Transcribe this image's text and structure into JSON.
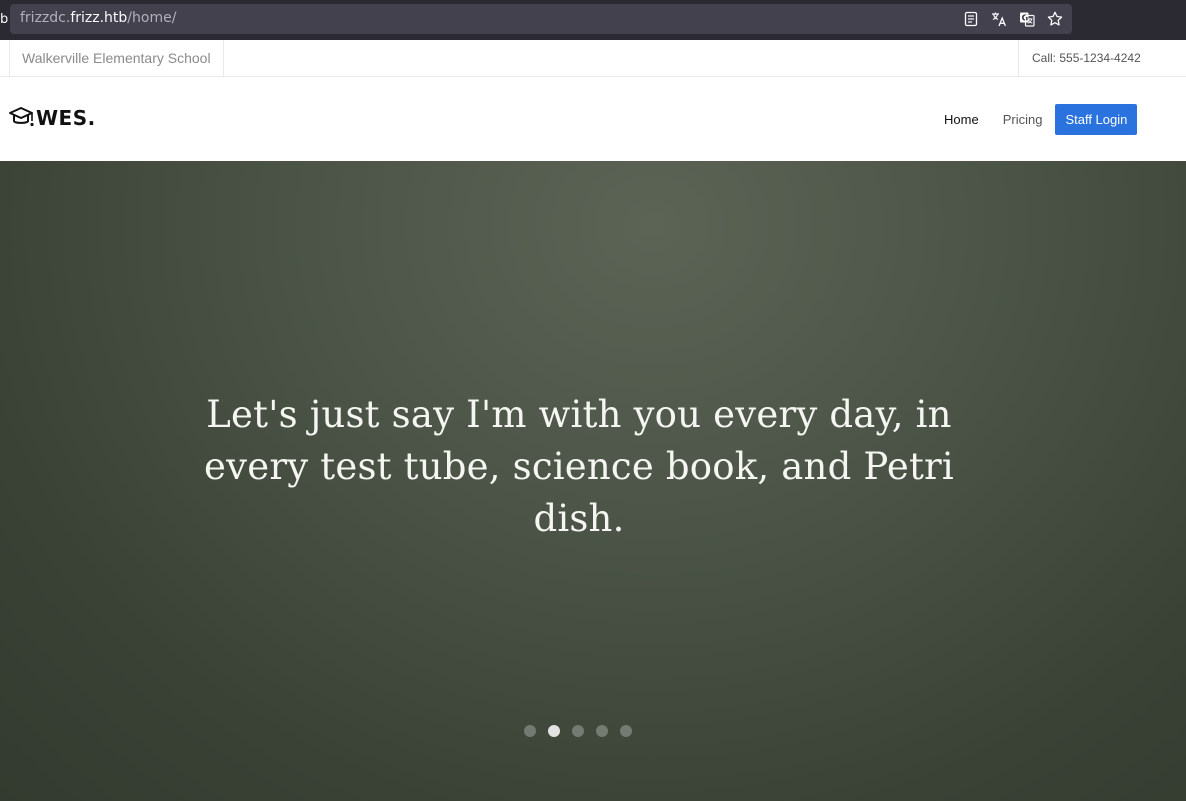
{
  "browser": {
    "tab_edge": "b",
    "url_prefix": "frizzdc.",
    "url_domain": "frizz.htb",
    "url_path": "/home/",
    "icons": [
      "reader-view-icon",
      "translate-icon",
      "translate-page-icon",
      "bookmark-star-icon"
    ]
  },
  "topbar": {
    "school_name": "Walkerville Elementary School",
    "call": "Call: 555-1234-4242"
  },
  "navbar": {
    "logo_text": "WES.",
    "links": [
      {
        "label": "Home",
        "active": true
      },
      {
        "label": "Pricing",
        "active": false
      }
    ],
    "staff_login": "Staff Login",
    "accent_color": "#2a72de"
  },
  "hero": {
    "quote": "Let's just say I'm with you every day, in every test tube, science book, and Petri dish.",
    "slides": 5,
    "active_slide": 2
  }
}
